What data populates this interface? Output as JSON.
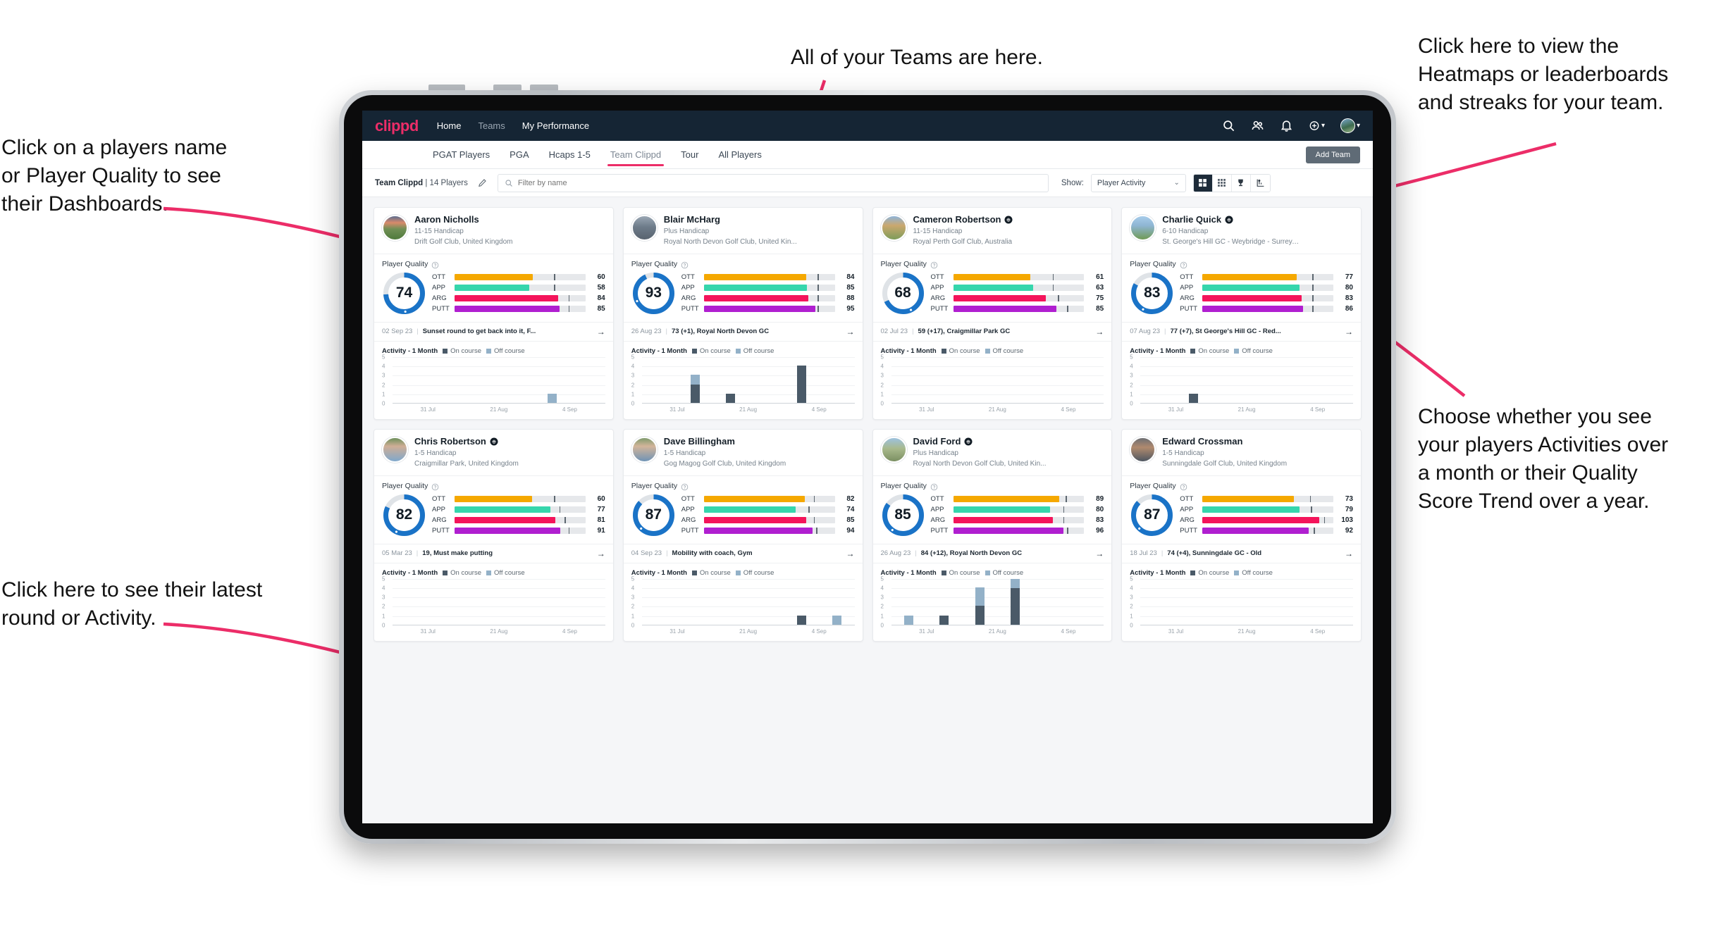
{
  "annotations": {
    "top_left": "Click on a players name\nor Player Quality to see\ntheir Dashboards.",
    "bottom_left": "Click here to see their latest\nround or Activity.",
    "top_center": "All of your Teams are here.",
    "top_right": "Click here to view the\nHeatmaps or leaderboards\nand streaks for your team.",
    "bottom_right": "Choose whether you see\nyour players Activities over\na month or their Quality\nScore Trend over a year."
  },
  "appbar": {
    "logo": "clippd",
    "nav": [
      {
        "label": "Home",
        "active": true
      },
      {
        "label": "Teams",
        "active": false
      },
      {
        "label": "My Performance",
        "active": true
      }
    ],
    "icons": [
      "search-icon",
      "people-icon",
      "bell-icon",
      "plus-circle-icon",
      "avatar"
    ]
  },
  "tabs": {
    "items": [
      "PGAT Players",
      "PGA",
      "Hcaps 1-5",
      "Team Clippd",
      "Tour",
      "All Players"
    ],
    "active": "Team Clippd",
    "add_team_label": "Add Team"
  },
  "toolbar": {
    "team_name": "Team Clippd",
    "player_count": "14 Players",
    "search_placeholder": "Filter by name",
    "search_value": "",
    "show_label": "Show:",
    "show_value": "Player Activity",
    "view_buttons": [
      "grid-large-icon",
      "grid-small-icon",
      "trophy-icon",
      "streaks-icon"
    ],
    "active_view": "grid-large-icon"
  },
  "card_labels": {
    "player_quality": "Player Quality",
    "activity": "Activity - 1 Month",
    "legend_on": "On course",
    "legend_off": "Off course",
    "metrics": [
      "OTT",
      "APP",
      "ARG",
      "PUTT"
    ],
    "x_ticks": [
      "31 Jul",
      "21 Aug",
      "4 Sep"
    ],
    "y_ticks": [
      "5",
      "4",
      "3",
      "2",
      "1",
      "0"
    ]
  },
  "colors": {
    "brand_pink": "#ec2d68",
    "header_navy": "#152534",
    "ring_blue": "#1a73c7",
    "ott": "#f5a800",
    "app": "#36d6ac",
    "arg": "#f4145b",
    "putt": "#b01fd0",
    "on_course": "#4a5a68",
    "off_course": "#93b1c8"
  },
  "players": [
    {
      "name": "Aaron Nicholls",
      "verified": false,
      "handicap": "11-15 Handicap",
      "club": "Drift Golf Club, United Kingdom",
      "quality": 74,
      "metrics": [
        {
          "label": "OTT",
          "value": 60,
          "fill_pct": 60,
          "tick_pct": 76
        },
        {
          "label": "APP",
          "value": 58,
          "fill_pct": 57,
          "tick_pct": 76
        },
        {
          "label": "ARG",
          "value": 84,
          "fill_pct": 79,
          "tick_pct": 87
        },
        {
          "label": "PUTT",
          "value": 85,
          "fill_pct": 80,
          "tick_pct": 87
        }
      ],
      "latest_date": "02 Sep 23",
      "latest_text": "Sunset round to get back into it, F...",
      "avatar_css": "linear-gradient(180deg,#5b6d8f 0%,#d98a6a 28%,#6f8f55 55%,#4f7a3c 100%)",
      "activity": [
        {
          "on": 0,
          "off": 0
        },
        {
          "on": 0,
          "off": 0
        },
        {
          "on": 0,
          "off": 0
        },
        {
          "on": 0,
          "off": 0
        },
        {
          "on": 0,
          "off": 1
        },
        {
          "on": 0,
          "off": 0
        }
      ]
    },
    {
      "name": "Blair McHarg",
      "verified": false,
      "handicap": "Plus Handicap",
      "club": "Royal North Devon Golf Club, United Kin...",
      "quality": 93,
      "metrics": [
        {
          "label": "OTT",
          "value": 84,
          "fill_pct": 78,
          "tick_pct": 87
        },
        {
          "label": "APP",
          "value": 85,
          "fill_pct": 79,
          "tick_pct": 87
        },
        {
          "label": "ARG",
          "value": 88,
          "fill_pct": 80,
          "tick_pct": 87
        },
        {
          "label": "PUTT",
          "value": 95,
          "fill_pct": 85,
          "tick_pct": 87
        }
      ],
      "latest_date": "26 Aug 23",
      "latest_text": "73 (+1), Royal North Devon GC",
      "avatar_css": "linear-gradient(180deg,#9aa7b4 0%,#6e7c8a 45%,#58636f 100%)",
      "activity": [
        {
          "on": 0,
          "off": 0
        },
        {
          "on": 2,
          "off": 1
        },
        {
          "on": 1,
          "off": 0
        },
        {
          "on": 0,
          "off": 0
        },
        {
          "on": 4,
          "off": 0
        },
        {
          "on": 0,
          "off": 0
        }
      ]
    },
    {
      "name": "Cameron Robertson",
      "verified": true,
      "handicap": "11-15 Handicap",
      "club": "Royal Perth Golf Club, Australia",
      "quality": 68,
      "metrics": [
        {
          "label": "OTT",
          "value": 61,
          "fill_pct": 59,
          "tick_pct": 76
        },
        {
          "label": "APP",
          "value": 63,
          "fill_pct": 61,
          "tick_pct": 76
        },
        {
          "label": "ARG",
          "value": 75,
          "fill_pct": 71,
          "tick_pct": 80
        },
        {
          "label": "PUTT",
          "value": 85,
          "fill_pct": 79,
          "tick_pct": 87
        }
      ],
      "latest_date": "02 Jul 23",
      "latest_text": "59 (+17), Craigmillar Park GC",
      "avatar_css": "linear-gradient(180deg,#8fb4d9 0%,#caa86e 40%,#7d9c5a 100%)",
      "activity": [
        {
          "on": 0,
          "off": 0
        },
        {
          "on": 0,
          "off": 0
        },
        {
          "on": 0,
          "off": 0
        },
        {
          "on": 0,
          "off": 0
        },
        {
          "on": 0,
          "off": 0
        },
        {
          "on": 0,
          "off": 0
        }
      ]
    },
    {
      "name": "Charlie Quick",
      "verified": true,
      "handicap": "6-10 Handicap",
      "club": "St. George's Hill GC - Weybridge - Surrey, ...",
      "quality": 83,
      "metrics": [
        {
          "label": "OTT",
          "value": 77,
          "fill_pct": 72,
          "tick_pct": 84
        },
        {
          "label": "APP",
          "value": 80,
          "fill_pct": 74,
          "tick_pct": 84
        },
        {
          "label": "ARG",
          "value": 83,
          "fill_pct": 76,
          "tick_pct": 84
        },
        {
          "label": "PUTT",
          "value": 86,
          "fill_pct": 77,
          "tick_pct": 84
        }
      ],
      "latest_date": "07 Aug 23",
      "latest_text": "77 (+7), St George's Hill GC - Red...",
      "avatar_css": "linear-gradient(180deg,#a7ccea 0%,#8fb6d4 40%,#6f9a54 100%)",
      "activity": [
        {
          "on": 0,
          "off": 0
        },
        {
          "on": 1,
          "off": 0
        },
        {
          "on": 0,
          "off": 0
        },
        {
          "on": 0,
          "off": 0
        },
        {
          "on": 0,
          "off": 0
        },
        {
          "on": 0,
          "off": 0
        }
      ]
    },
    {
      "name": "Chris Robertson",
      "verified": true,
      "handicap": "1-5 Handicap",
      "club": "Craigmillar Park, United Kingdom",
      "quality": 82,
      "metrics": [
        {
          "label": "OTT",
          "value": 60,
          "fill_pct": 59,
          "tick_pct": 76
        },
        {
          "label": "APP",
          "value": 77,
          "fill_pct": 73,
          "tick_pct": 80
        },
        {
          "label": "ARG",
          "value": 81,
          "fill_pct": 77,
          "tick_pct": 84
        },
        {
          "label": "PUTT",
          "value": 91,
          "fill_pct": 81,
          "tick_pct": 87
        }
      ],
      "latest_date": "05 Mar 23",
      "latest_text": "19, Must make putting",
      "avatar_css": "linear-gradient(180deg,#6d8f5a 0%,#cfae96 35%,#7fa8cc 100%)",
      "activity": [
        {
          "on": 0,
          "off": 0
        },
        {
          "on": 0,
          "off": 0
        },
        {
          "on": 0,
          "off": 0
        },
        {
          "on": 0,
          "off": 0
        },
        {
          "on": 0,
          "off": 0
        },
        {
          "on": 0,
          "off": 0
        }
      ]
    },
    {
      "name": "Dave Billingham",
      "verified": false,
      "handicap": "1-5 Handicap",
      "club": "Gog Magog Golf Club, United Kingdom",
      "quality": 87,
      "metrics": [
        {
          "label": "OTT",
          "value": 82,
          "fill_pct": 77,
          "tick_pct": 84
        },
        {
          "label": "APP",
          "value": 74,
          "fill_pct": 70,
          "tick_pct": 80
        },
        {
          "label": "ARG",
          "value": 85,
          "fill_pct": 78,
          "tick_pct": 84
        },
        {
          "label": "PUTT",
          "value": 94,
          "fill_pct": 83,
          "tick_pct": 86
        }
      ],
      "latest_date": "04 Sep 23",
      "latest_text": "Mobility with coach, Gym",
      "avatar_css": "linear-gradient(180deg,#7f9a6c 0%,#d3b59a 35%,#6f93b5 100%)",
      "activity": [
        {
          "on": 0,
          "off": 0
        },
        {
          "on": 0,
          "off": 0
        },
        {
          "on": 0,
          "off": 0
        },
        {
          "on": 0,
          "off": 0
        },
        {
          "on": 1,
          "off": 0
        },
        {
          "on": 0,
          "off": 1
        }
      ]
    },
    {
      "name": "David Ford",
      "verified": true,
      "handicap": "Plus Handicap",
      "club": "Royal North Devon Golf Club, United Kin...",
      "quality": 85,
      "metrics": [
        {
          "label": "OTT",
          "value": 89,
          "fill_pct": 81,
          "tick_pct": 86
        },
        {
          "label": "APP",
          "value": 80,
          "fill_pct": 74,
          "tick_pct": 84
        },
        {
          "label": "ARG",
          "value": 83,
          "fill_pct": 76,
          "tick_pct": 84
        },
        {
          "label": "PUTT",
          "value": 96,
          "fill_pct": 84,
          "tick_pct": 87
        }
      ],
      "latest_date": "26 Aug 23",
      "latest_text": "84 (+12), Royal North Devon GC",
      "avatar_css": "linear-gradient(180deg,#9dc2df 0%,#a8b98c 45%,#7b8f62 100%)",
      "activity": [
        {
          "on": 0,
          "off": 1
        },
        {
          "on": 1,
          "off": 0
        },
        {
          "on": 2,
          "off": 2
        },
        {
          "on": 4,
          "off": 1
        },
        {
          "on": 0,
          "off": 0
        },
        {
          "on": 0,
          "off": 0
        }
      ]
    },
    {
      "name": "Edward Crossman",
      "verified": false,
      "handicap": "1-5 Handicap",
      "club": "Sunningdale Golf Club, United Kingdom",
      "quality": 87,
      "metrics": [
        {
          "label": "OTT",
          "value": 73,
          "fill_pct": 70,
          "tick_pct": 82
        },
        {
          "label": "APP",
          "value": 79,
          "fill_pct": 74,
          "tick_pct": 83
        },
        {
          "label": "ARG",
          "value": 103,
          "fill_pct": 89,
          "tick_pct": 93
        },
        {
          "label": "PUTT",
          "value": 92,
          "fill_pct": 81,
          "tick_pct": 85
        }
      ],
      "latest_date": "18 Jul 23",
      "latest_text": "74 (+4), Sunningdale GC - Old",
      "avatar_css": "linear-gradient(180deg,#6c6f74 0%,#b08a6e 40%,#4e5661 100%)",
      "activity": [
        {
          "on": 0,
          "off": 0
        },
        {
          "on": 0,
          "off": 0
        },
        {
          "on": 0,
          "off": 0
        },
        {
          "on": 0,
          "off": 0
        },
        {
          "on": 0,
          "off": 0
        },
        {
          "on": 0,
          "off": 0
        }
      ]
    }
  ]
}
